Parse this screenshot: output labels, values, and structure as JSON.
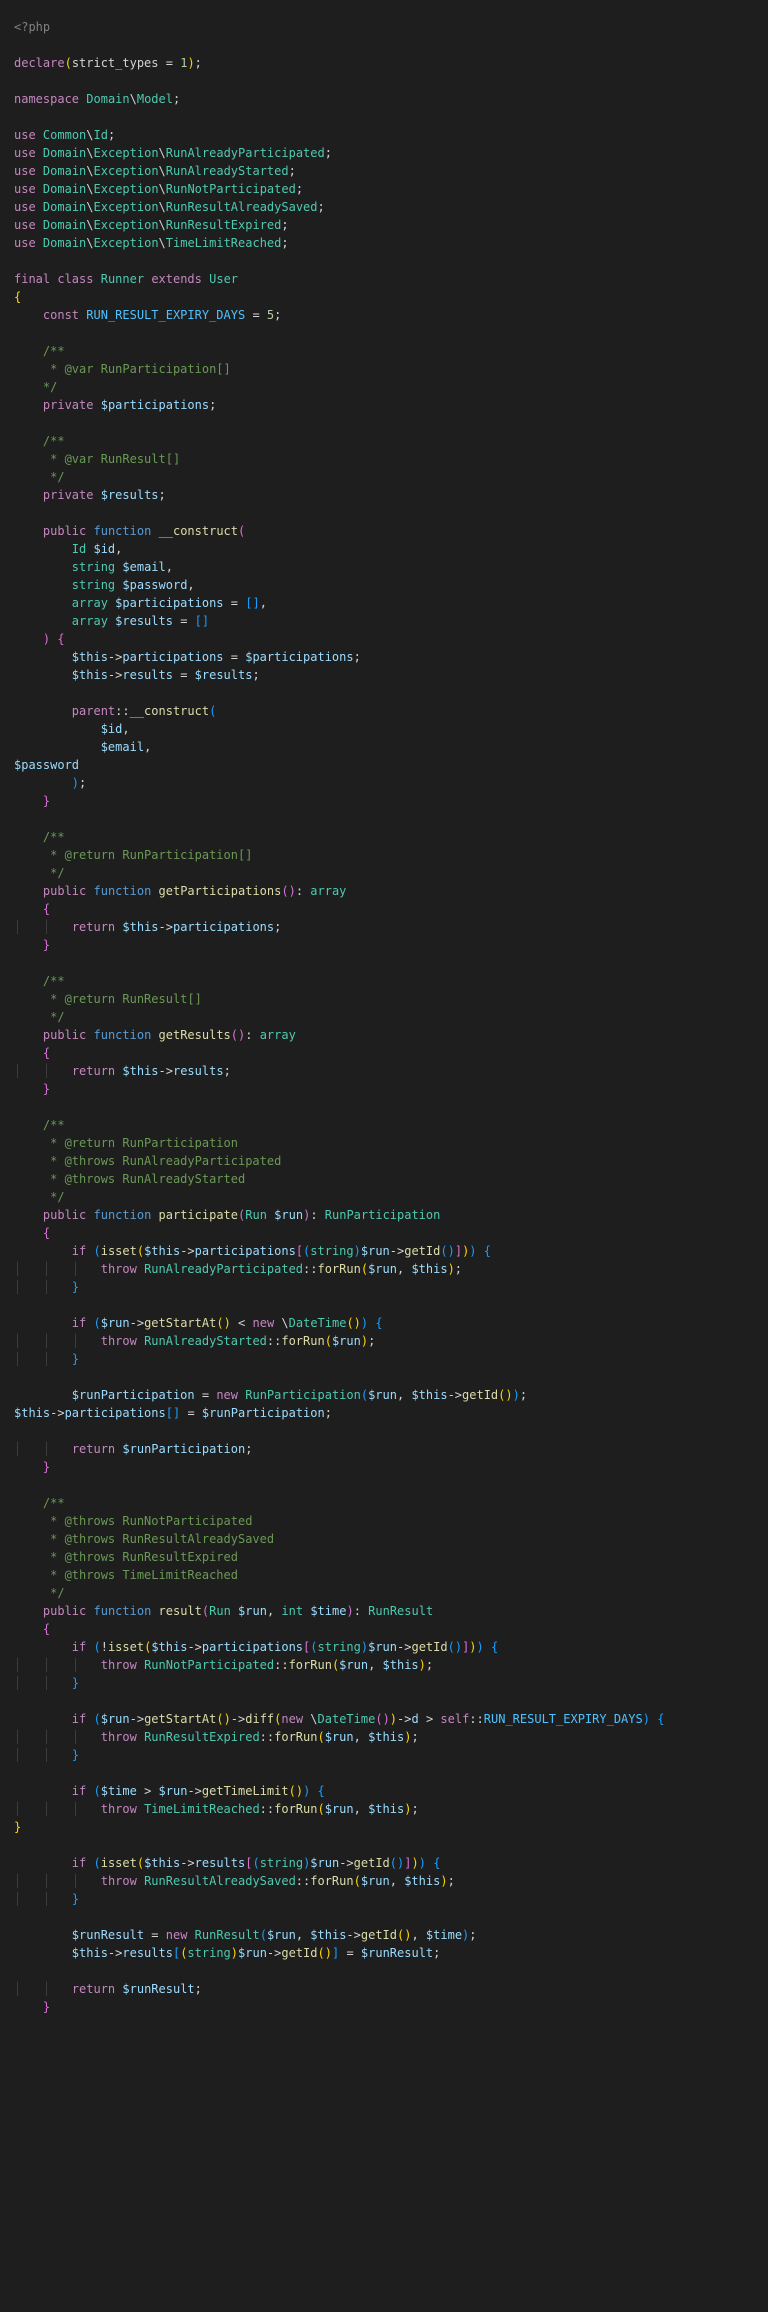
{
  "php_open": "<?php",
  "declare": {
    "kw": "declare",
    "arg": "strict_types",
    "eq": "=",
    "val": "1"
  },
  "namespace": {
    "kw": "namespace",
    "path": [
      "Domain",
      "Model"
    ]
  },
  "uses": [
    {
      "kw": "use",
      "ns": [
        "Common"
      ],
      "cls": "Id"
    },
    {
      "kw": "use",
      "ns": [
        "Domain",
        "Exception"
      ],
      "cls": "RunAlreadyParticipated"
    },
    {
      "kw": "use",
      "ns": [
        "Domain",
        "Exception"
      ],
      "cls": "RunAlreadyStarted"
    },
    {
      "kw": "use",
      "ns": [
        "Domain",
        "Exception"
      ],
      "cls": "RunNotParticipated"
    },
    {
      "kw": "use",
      "ns": [
        "Domain",
        "Exception"
      ],
      "cls": "RunResultAlreadySaved"
    },
    {
      "kw": "use",
      "ns": [
        "Domain",
        "Exception"
      ],
      "cls": "RunResultExpired"
    },
    {
      "kw": "use",
      "ns": [
        "Domain",
        "Exception"
      ],
      "cls": "TimeLimitReached"
    }
  ],
  "class_decl": {
    "final": "final",
    "class": "class",
    "name": "Runner",
    "extends": "extends",
    "parent": "User"
  },
  "const_line": {
    "kw": "const",
    "name": "RUN_RESULT_EXPIRY_DAYS",
    "eq": "=",
    "val": "5"
  },
  "doc1": {
    "open": "/**",
    "l1": " * @var RunParticipation[]",
    "close": " */"
  },
  "prop1": {
    "vis": "private",
    "name": "$participations"
  },
  "doc2": {
    "open": "/**",
    "l1": " * @var RunResult[]",
    "close": " */"
  },
  "prop2": {
    "vis": "private",
    "name": "$results"
  },
  "ctor": {
    "vis": "public",
    "fn": "function",
    "name": "__construct",
    "params": [
      {
        "type": "Id",
        "var": "$id"
      },
      {
        "type": "string",
        "var": "$email"
      },
      {
        "type": "string",
        "var": "$password"
      },
      {
        "type": "array",
        "var": "$participations",
        "def": "[]"
      },
      {
        "type": "array",
        "var": "$results",
        "def": "[]"
      }
    ],
    "body_assign1": {
      "lhs": "$this->participations",
      "rhs": "$participations"
    },
    "body_assign2": {
      "lhs": "$this->results",
      "rhs": "$results"
    },
    "parent_call": {
      "kw": "parent",
      "op": "::",
      "m": "__construct",
      "args": [
        "$id",
        "$email"
      ],
      "wrapped_arg": "$password"
    }
  },
  "getParticipations": {
    "doc": {
      "open": "/**",
      "l1": " * @return RunParticipation[]",
      "close": " */"
    },
    "vis": "public",
    "fn": "function",
    "name": "getParticipations",
    "rt": "array",
    "ret": "$this->participations"
  },
  "getResults": {
    "doc": {
      "open": "/**",
      "l1": " * @return RunResult[]",
      "close": " */"
    },
    "vis": "public",
    "fn": "function",
    "name": "getResults",
    "rt": "array",
    "ret": "$this->results"
  },
  "participate": {
    "doc": {
      "open": "/**",
      "l1": " * @return RunParticipation",
      "l2": " * @throws RunAlreadyParticipated",
      "l3": " * @throws RunAlreadyStarted",
      "close": " */"
    },
    "vis": "public",
    "fn": "function",
    "name": "participate",
    "param": {
      "type": "Run",
      "var": "$run"
    },
    "rt": "RunParticipation",
    "if1": "if (isset($this->participations[(string)$run->getId()])) {",
    "throw1": "throw RunAlreadyParticipated::forRun($run, $this);",
    "if2": "if ($run->getStartAt() < new \\DateTime()) {",
    "throw2": "throw RunAlreadyStarted::forRun($run);",
    "assign": "$runParticipation = new RunParticipation($run, $this->getId());",
    "push": "$this->participations[] = $runParticipation;",
    "ret": "return $runParticipation;"
  },
  "result": {
    "doc": {
      "open": "/**",
      "l1": " * @throws RunNotParticipated",
      "l2": " * @throws RunResultAlreadySaved",
      "l3": " * @throws RunResultExpired",
      "l4": " * @throws TimeLimitReached",
      "close": " */"
    },
    "vis": "public",
    "fn": "function",
    "name": "result",
    "p1": {
      "type": "Run",
      "var": "$run"
    },
    "p2": {
      "type": "int",
      "var": "$time"
    },
    "rt": "RunResult",
    "if1": "if (!isset($this->participations[(string)$run->getId()])) {",
    "throw1": "throw RunNotParticipated::forRun($run, $this);",
    "if2": "if ($run->getStartAt()->diff(new \\DateTime())->d > self::RUN_RESULT_EXPIRY_DAYS) {",
    "throw2": "throw RunResultExpired::forRun($run, $this);",
    "if3": "if ($time > $run->getTimeLimit()) {",
    "throw3": "throw TimeLimitReached::forRun($run, $this);",
    "extra_close": "}",
    "if4": "if (isset($this->results[(string)$run->getId()])) {",
    "throw4": "throw RunResultAlreadySaved::forRun($run, $this);",
    "assign": "$runResult = new RunResult($run, $this->getId(), $time);",
    "push": "$this->results[(string)$run->getId()] = $runResult;",
    "ret": "return $runResult;"
  }
}
